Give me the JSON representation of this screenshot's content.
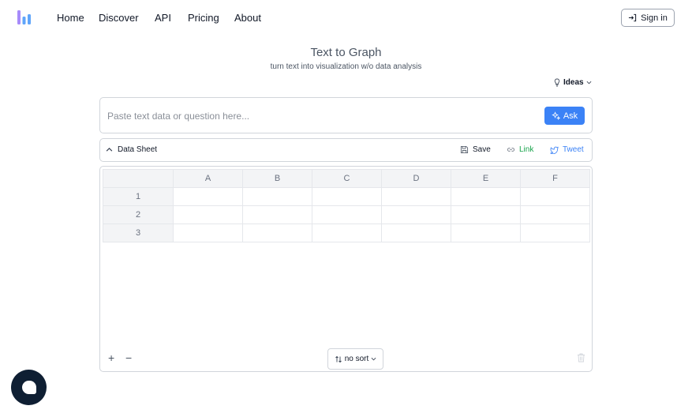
{
  "nav": {
    "links": [
      "Home",
      "Discover",
      "API",
      "Pricing",
      "About"
    ],
    "signin_label": "Sign in"
  },
  "hero": {
    "title": "Text to Graph",
    "subtitle": "turn text into visualization w/o data analysis",
    "ideas_label": "Ideas"
  },
  "search": {
    "placeholder": "Paste text data or question here...",
    "value": "",
    "ask_label": "Ask"
  },
  "sheet_bar": {
    "title": "Data Sheet",
    "save_label": "Save",
    "link_label": "Link",
    "tweet_label": "Tweet"
  },
  "grid": {
    "columns": [
      "A",
      "B",
      "C",
      "D",
      "E",
      "F"
    ],
    "rows": [
      "1",
      "2",
      "3"
    ],
    "add_label": "+",
    "remove_label": "−",
    "sort_label": "no sort"
  },
  "colors": {
    "accent": "#3b82f6",
    "link_green": "#16a34a",
    "tweet_blue": "#3b82f6",
    "chat_bg": "#0f1f33"
  }
}
